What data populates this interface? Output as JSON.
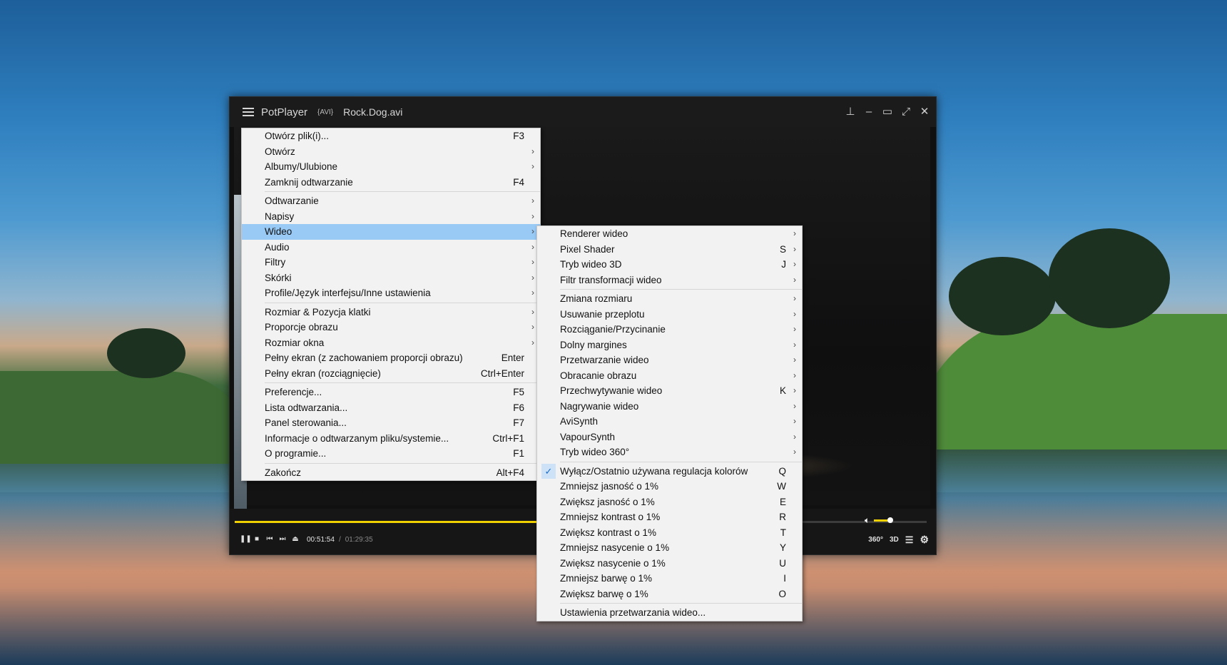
{
  "player": {
    "app_name": "PotPlayer",
    "format": "{AVI}",
    "filename": "Rock.Dog.avi",
    "window_buttons": [
      "pin-icon",
      "minimize-icon",
      "maximize-icon",
      "fullscreen-icon",
      "close-icon"
    ],
    "progress_fraction": 0.58,
    "volume_fraction": 0.6,
    "time_current": "00:51:54",
    "time_separator": "/",
    "time_total": "01:29:35",
    "btn_360": "360°",
    "btn_3d": "3D",
    "accent_color": "#f0d000"
  },
  "main_menu": {
    "groups": [
      [
        {
          "label": "Otwórz plik(i)...",
          "shortcut": "F3",
          "submenu": false
        },
        {
          "label": "Otwórz",
          "shortcut": "",
          "submenu": true
        },
        {
          "label": "Albumy/Ulubione",
          "shortcut": "",
          "submenu": true
        },
        {
          "label": "Zamknij odtwarzanie",
          "shortcut": "F4",
          "submenu": false
        }
      ],
      [
        {
          "label": "Odtwarzanie",
          "shortcut": "",
          "submenu": true
        },
        {
          "label": "Napisy",
          "shortcut": "",
          "submenu": true
        },
        {
          "label": "Wideo",
          "shortcut": "",
          "submenu": true,
          "selected": true
        },
        {
          "label": "Audio",
          "shortcut": "",
          "submenu": true
        },
        {
          "label": "Filtry",
          "shortcut": "",
          "submenu": true
        },
        {
          "label": "Skórki",
          "shortcut": "",
          "submenu": true
        },
        {
          "label": "Profile/Język interfejsu/Inne ustawienia",
          "shortcut": "",
          "submenu": true
        }
      ],
      [
        {
          "label": "Rozmiar & Pozycja klatki",
          "shortcut": "",
          "submenu": true
        },
        {
          "label": "Proporcje obrazu",
          "shortcut": "",
          "submenu": true
        },
        {
          "label": "Rozmiar okna",
          "shortcut": "",
          "submenu": true
        },
        {
          "label": "Pełny ekran (z zachowaniem proporcji obrazu)",
          "shortcut": "Enter",
          "submenu": false
        },
        {
          "label": "Pełny ekran (rozciągnięcie)",
          "shortcut": "Ctrl+Enter",
          "submenu": false
        }
      ],
      [
        {
          "label": "Preferencje...",
          "shortcut": "F5",
          "submenu": false
        },
        {
          "label": "Lista odtwarzania...",
          "shortcut": "F6",
          "submenu": false
        },
        {
          "label": "Panel sterowania...",
          "shortcut": "F7",
          "submenu": false
        },
        {
          "label": "Informacje o odtwarzanym pliku/systemie...",
          "shortcut": "Ctrl+F1",
          "submenu": false
        },
        {
          "label": "O programie...",
          "shortcut": "F1",
          "submenu": false
        }
      ],
      [
        {
          "label": "Zakończ",
          "shortcut": "Alt+F4",
          "submenu": false
        }
      ]
    ]
  },
  "video_menu": {
    "groups": [
      [
        {
          "label": "Renderer wideo",
          "shortcut": "",
          "submenu": true
        },
        {
          "label": "Pixel Shader",
          "shortcut": "S",
          "submenu": true
        },
        {
          "label": "Tryb wideo 3D",
          "shortcut": "J",
          "submenu": true
        },
        {
          "label": "Filtr transformacji wideo",
          "shortcut": "",
          "submenu": true
        }
      ],
      [
        {
          "label": "Zmiana rozmiaru",
          "shortcut": "",
          "submenu": true
        },
        {
          "label": "Usuwanie przeplotu",
          "shortcut": "",
          "submenu": true
        },
        {
          "label": "Rozciąganie/Przycinanie",
          "shortcut": "",
          "submenu": true
        },
        {
          "label": "Dolny margines",
          "shortcut": "",
          "submenu": true
        },
        {
          "label": "Przetwarzanie wideo",
          "shortcut": "",
          "submenu": true
        },
        {
          "label": "Obracanie obrazu",
          "shortcut": "",
          "submenu": true
        },
        {
          "label": "Przechwytywanie wideo",
          "shortcut": "K",
          "submenu": true
        },
        {
          "label": "Nagrywanie wideo",
          "shortcut": "",
          "submenu": true
        },
        {
          "label": "AviSynth",
          "shortcut": "",
          "submenu": true
        },
        {
          "label": "VapourSynth",
          "shortcut": "",
          "submenu": true
        },
        {
          "label": "Tryb wideo 360°",
          "shortcut": "",
          "submenu": true
        }
      ],
      [
        {
          "label": "Wyłącz/Ostatnio używana regulacja kolorów",
          "shortcut": "Q",
          "submenu": false,
          "checked": true
        },
        {
          "label": "Zmniejsz jasność o 1%",
          "shortcut": "W",
          "submenu": false
        },
        {
          "label": "Zwiększ jasność o 1%",
          "shortcut": "E",
          "submenu": false
        },
        {
          "label": "Zmniejsz kontrast o 1%",
          "shortcut": "R",
          "submenu": false
        },
        {
          "label": "Zwiększ kontrast o 1%",
          "shortcut": "T",
          "submenu": false
        },
        {
          "label": "Zmniejsz nasycenie o 1%",
          "shortcut": "Y",
          "submenu": false
        },
        {
          "label": "Zwiększ nasycenie o 1%",
          "shortcut": "U",
          "submenu": false
        },
        {
          "label": "Zmniejsz barwę o 1%",
          "shortcut": "I",
          "submenu": false
        },
        {
          "label": "Zwiększ barwę o 1%",
          "shortcut": "O",
          "submenu": false
        }
      ],
      [
        {
          "label": "Ustawienia przetwarzania wideo...",
          "shortcut": "",
          "submenu": false
        }
      ]
    ]
  }
}
